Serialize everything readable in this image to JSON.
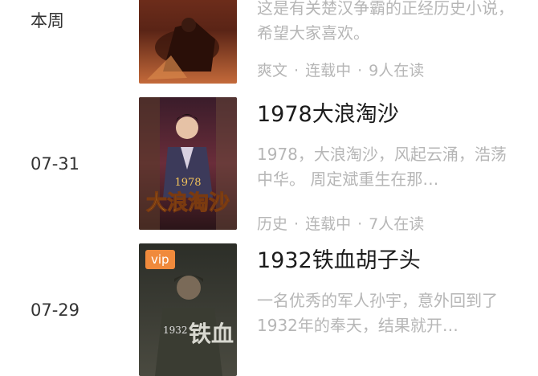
{
  "items": [
    {
      "date": "本周",
      "title": "",
      "desc": "这是有关楚汉争霸的正经历史小说，希望大家喜欢。",
      "meta": {
        "category": "爽文",
        "status": "连载中",
        "readers": "9人在读"
      }
    },
    {
      "date": "07-31",
      "title": "1978大浪淘沙",
      "desc": "1978，大浪淘沙，风起云涌，浩荡中华。 周定斌重生在那…",
      "meta": {
        "category": "历史",
        "status": "连载中",
        "readers": "7人在读"
      },
      "cover_text": {
        "year": "1978",
        "name": "大浪淘沙"
      }
    },
    {
      "date": "07-29",
      "title": "1932铁血胡子头",
      "desc": "一名优秀的军人孙宇，意外回到了1932年的奉天，结果就开…",
      "badge": "vip",
      "cover_text": {
        "year": "1932",
        "name": "铁血"
      }
    }
  ],
  "separator": "·"
}
